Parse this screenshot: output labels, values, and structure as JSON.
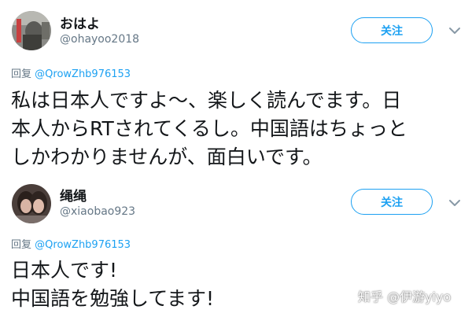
{
  "colors": {
    "accent": "#1da1f2",
    "text": "#14171a",
    "secondary_text": "#657786"
  },
  "tweets": [
    {
      "display_name": "おはよ",
      "handle": "@ohayoo2018",
      "follow_label": "关注",
      "reply_prefix": "回复",
      "reply_mention": "@QrowZhb976153",
      "text_lines": [
        "私は日本人ですよ〜、楽しく読んでます。日",
        "本人からRTされてくるし。中国語はちょっと",
        "しかわかりませんが、面白いです。"
      ],
      "menu_icon": "chevron-down-icon"
    },
    {
      "display_name": "绳绳",
      "handle": "@xiaobao923",
      "follow_label": "关注",
      "reply_prefix": "回复",
      "reply_mention": "@QrowZhb976153",
      "text_lines": [
        "日本人です!",
        "中国語を勉強してます!"
      ],
      "menu_icon": "chevron-down-icon"
    }
  ],
  "watermark": {
    "text": "知乎 @伊游yiyo"
  }
}
